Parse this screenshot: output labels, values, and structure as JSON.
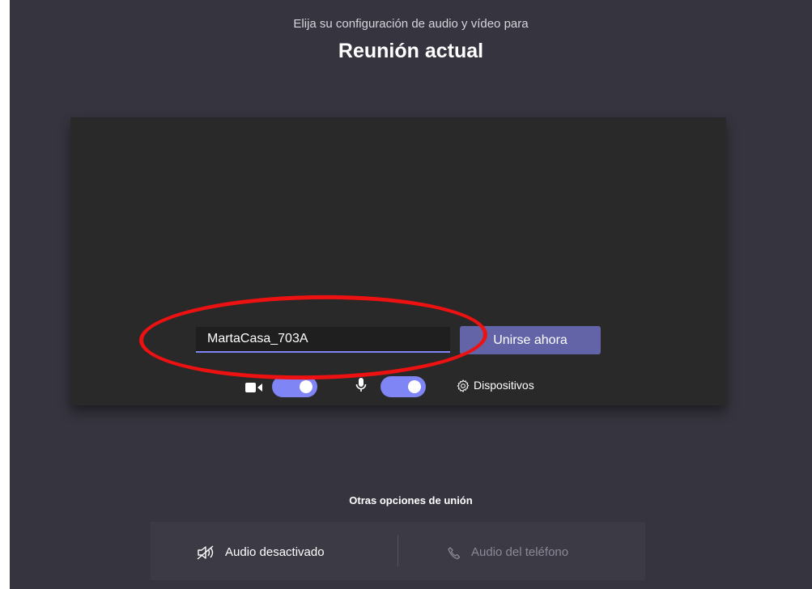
{
  "header": {
    "subtitle": "Elija su configuración de audio y vídeo para",
    "title": "Reunión actual"
  },
  "join": {
    "name_value": "MartaCasa_703A",
    "join_label": "Unirse ahora"
  },
  "controls": {
    "camera_icon": "video-camera-icon",
    "camera_on": true,
    "mic_icon": "microphone-icon",
    "mic_on": true,
    "devices_icon": "gear-icon",
    "devices_label": "Dispositivos"
  },
  "other_options": {
    "heading": "Otras opciones de unión",
    "audio_off_icon": "speaker-off-icon",
    "audio_off_label": "Audio desactivado",
    "phone_icon": "phone-icon",
    "phone_label": "Audio del teléfono"
  },
  "colors": {
    "background": "#36353f",
    "preview": "#292929",
    "accent": "#6264a7",
    "toggle": "#7f85f5",
    "annotation": "#ee1111"
  }
}
